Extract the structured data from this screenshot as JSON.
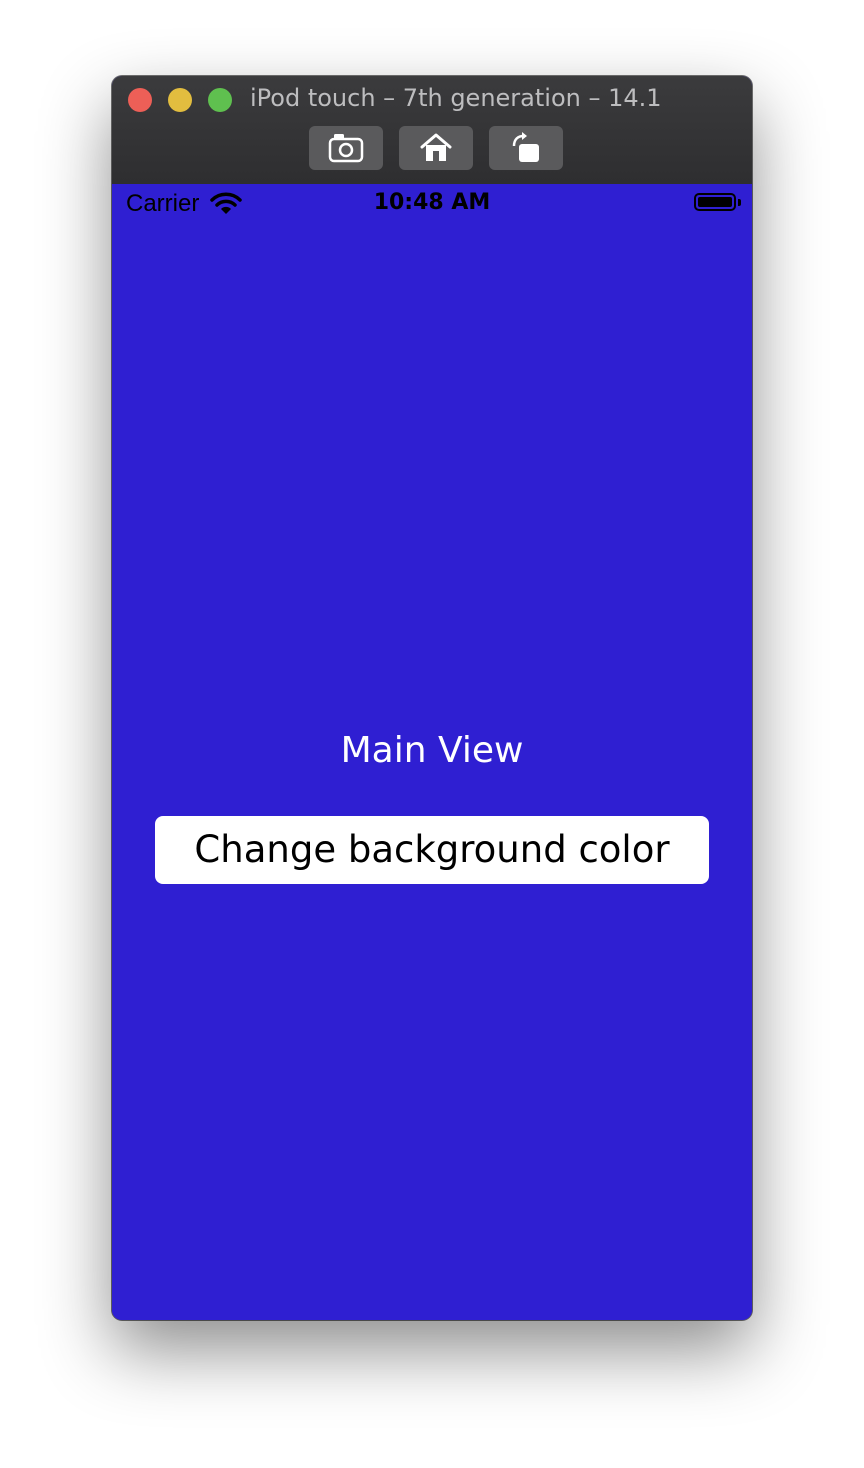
{
  "window": {
    "title": "iPod touch – 7th generation – 14.1",
    "toolbar": [
      {
        "icon": "screenshot-camera-icon"
      },
      {
        "icon": "home-icon"
      },
      {
        "icon": "rotate-icon"
      }
    ]
  },
  "status_bar": {
    "carrier": "Carrier",
    "time": "10:48 AM",
    "wifi_icon": "wifi-icon",
    "battery_icon": "battery-icon",
    "battery_level": 1.0
  },
  "main": {
    "title": "Main View",
    "button_label": "Change background color",
    "background_color": "#2f1fd2",
    "button_color": "#ffffff"
  }
}
